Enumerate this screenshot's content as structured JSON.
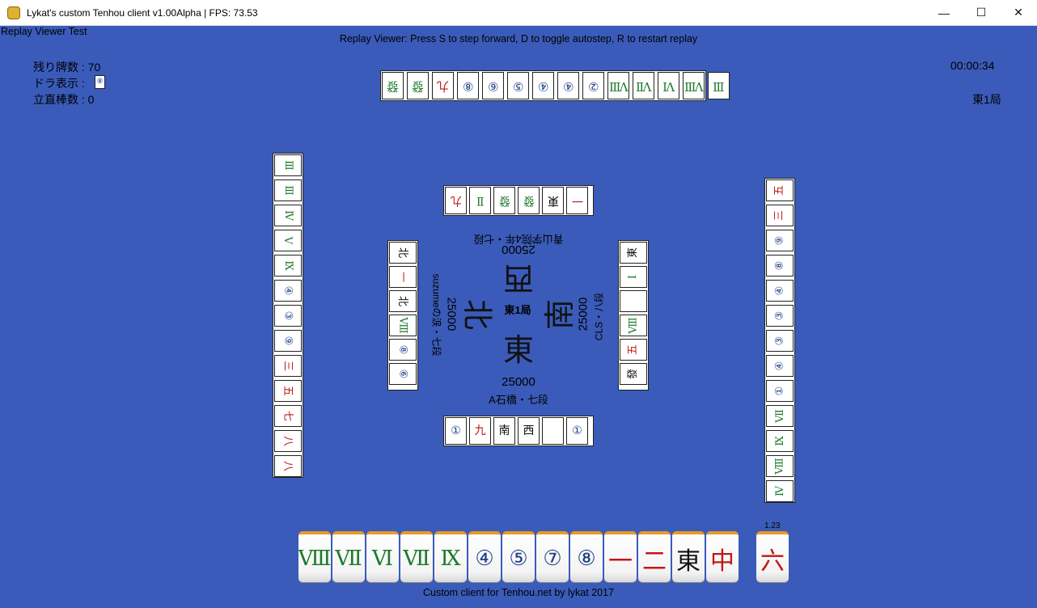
{
  "window": {
    "title": "Lykat's custom Tenhou client v1.00Alpha | FPS: 73.53",
    "minimize_glyph": "—",
    "maximize_glyph": "☐",
    "close_glyph": "✕"
  },
  "header": {
    "test_label": "Replay Viewer Test",
    "instructions": "Replay Viewer: Press S to step forward, D to toggle autostep, R to restart replay"
  },
  "status": {
    "remaining": "残り牌数 : 70",
    "dora_label": "ドラ表示 :",
    "riichi_sticks": "立直棒数 : 0",
    "timer": "00:00:34",
    "round": "東1局"
  },
  "top_hand": {
    "tiles": [
      {
        "face": "發",
        "suit": "sou"
      },
      {
        "face": "發",
        "suit": "sou"
      },
      {
        "face": "九",
        "suit": "man"
      },
      {
        "face": "⑧",
        "suit": "pin"
      },
      {
        "face": "⑥",
        "suit": "pin"
      },
      {
        "face": "⑤",
        "suit": "pin"
      },
      {
        "face": "④",
        "suit": "pin"
      },
      {
        "face": "④",
        "suit": "pin"
      },
      {
        "face": "②",
        "suit": "pin"
      },
      {
        "face": "Ⅷ",
        "suit": "sou"
      },
      {
        "face": "Ⅶ",
        "suit": "sou"
      },
      {
        "face": "Ⅵ",
        "suit": "sou"
      },
      {
        "face": "Ⅷ",
        "suit": "sou"
      },
      {
        "face": "Ⅲ",
        "suit": "sou"
      }
    ]
  },
  "left_hand": {
    "tiles": [
      {
        "face": "Ⅲ",
        "suit": "sou"
      },
      {
        "face": "Ⅲ",
        "suit": "sou"
      },
      {
        "face": "Ⅳ",
        "suit": "sou"
      },
      {
        "face": "Ⅴ",
        "suit": "sou"
      },
      {
        "face": "Ⅸ",
        "suit": "sou"
      },
      {
        "face": "④",
        "suit": "pin"
      },
      {
        "face": "③",
        "suit": "pin"
      },
      {
        "face": "⑨",
        "suit": "pin"
      },
      {
        "face": "三",
        "suit": "man"
      },
      {
        "face": "五",
        "suit": "man"
      },
      {
        "face": "七",
        "suit": "man"
      },
      {
        "face": "八",
        "suit": "man"
      },
      {
        "face": "八",
        "suit": "man"
      }
    ]
  },
  "right_hand": {
    "tiles": [
      {
        "face": "五",
        "suit": "man"
      },
      {
        "face": "三",
        "suit": "man"
      },
      {
        "face": "⑨",
        "suit": "pin"
      },
      {
        "face": "⑧",
        "suit": "pin"
      },
      {
        "face": "④",
        "suit": "pin"
      },
      {
        "face": "③",
        "suit": "pin"
      },
      {
        "face": "③",
        "suit": "pin"
      },
      {
        "face": "④",
        "suit": "pin"
      },
      {
        "face": "①",
        "suit": "pin"
      },
      {
        "face": "Ⅶ",
        "suit": "sou"
      },
      {
        "face": "Ⅸ",
        "suit": "sou"
      },
      {
        "face": "Ⅷ",
        "suit": "sou"
      },
      {
        "face": "Ⅳ",
        "suit": "sou"
      }
    ]
  },
  "discards": {
    "top": [
      {
        "face": "九",
        "suit": "man"
      },
      {
        "face": "Ⅱ",
        "suit": "sou"
      },
      {
        "face": "發",
        "suit": "sou"
      },
      {
        "face": "發",
        "suit": "sou"
      },
      {
        "face": "東",
        "suit": "hon"
      },
      {
        "face": "一",
        "suit": "man"
      }
    ],
    "left": [
      {
        "face": "北",
        "suit": "hon"
      },
      {
        "face": "一",
        "suit": "man"
      },
      {
        "face": "北",
        "suit": "hon"
      },
      {
        "face": "Ⅷ",
        "suit": "sou"
      },
      {
        "face": "⑧",
        "suit": "pin"
      },
      {
        "face": "⑥",
        "suit": "pin"
      }
    ],
    "right": [
      {
        "face": "東",
        "suit": "hon"
      },
      {
        "face": "Ⅰ",
        "suit": "sou"
      },
      {
        "face": "",
        "suit": "hon"
      },
      {
        "face": "Ⅷ",
        "suit": "sou"
      },
      {
        "face": "五",
        "suit": "man"
      },
      {
        "face": "發",
        "suit": "hon"
      }
    ],
    "bottom": [
      {
        "face": "①",
        "suit": "pin"
      },
      {
        "face": "九",
        "suit": "man"
      },
      {
        "face": "南",
        "suit": "hon"
      },
      {
        "face": "西",
        "suit": "hon"
      },
      {
        "face": "",
        "suit": "hon"
      },
      {
        "face": "①",
        "suit": "pin"
      }
    ]
  },
  "players": {
    "bottom": {
      "score": "25000",
      "name": "A石橋・七段",
      "wind": "東"
    },
    "right": {
      "score": "25000",
      "name": "CLS・八段",
      "wind": "南"
    },
    "top": {
      "score": "25000",
      "name": "青山学院4年・七段",
      "wind": "西"
    },
    "left": {
      "score": "25000",
      "name": "suzumeの涙・七段",
      "wind": "北"
    }
  },
  "center": {
    "round": "東1局"
  },
  "player_hand": {
    "tiles": [
      {
        "face": "Ⅷ",
        "suit": "sou"
      },
      {
        "face": "Ⅶ",
        "suit": "sou"
      },
      {
        "face": "Ⅵ",
        "suit": "sou"
      },
      {
        "face": "Ⅶ",
        "suit": "sou"
      },
      {
        "face": "Ⅸ",
        "suit": "sou"
      },
      {
        "face": "④",
        "suit": "pin"
      },
      {
        "face": "⑤",
        "suit": "pin"
      },
      {
        "face": "⑦",
        "suit": "pin"
      },
      {
        "face": "⑧",
        "suit": "pin"
      },
      {
        "face": "一",
        "suit": "man"
      },
      {
        "face": "二",
        "suit": "man"
      },
      {
        "face": "東",
        "suit": "hon"
      },
      {
        "face": "中",
        "suit": "red"
      }
    ],
    "drawn": {
      "face": "六",
      "suit": "man",
      "label": "1.23"
    }
  },
  "footer": {
    "credit": "Custom client for Tenhou.net by lykat 2017"
  }
}
